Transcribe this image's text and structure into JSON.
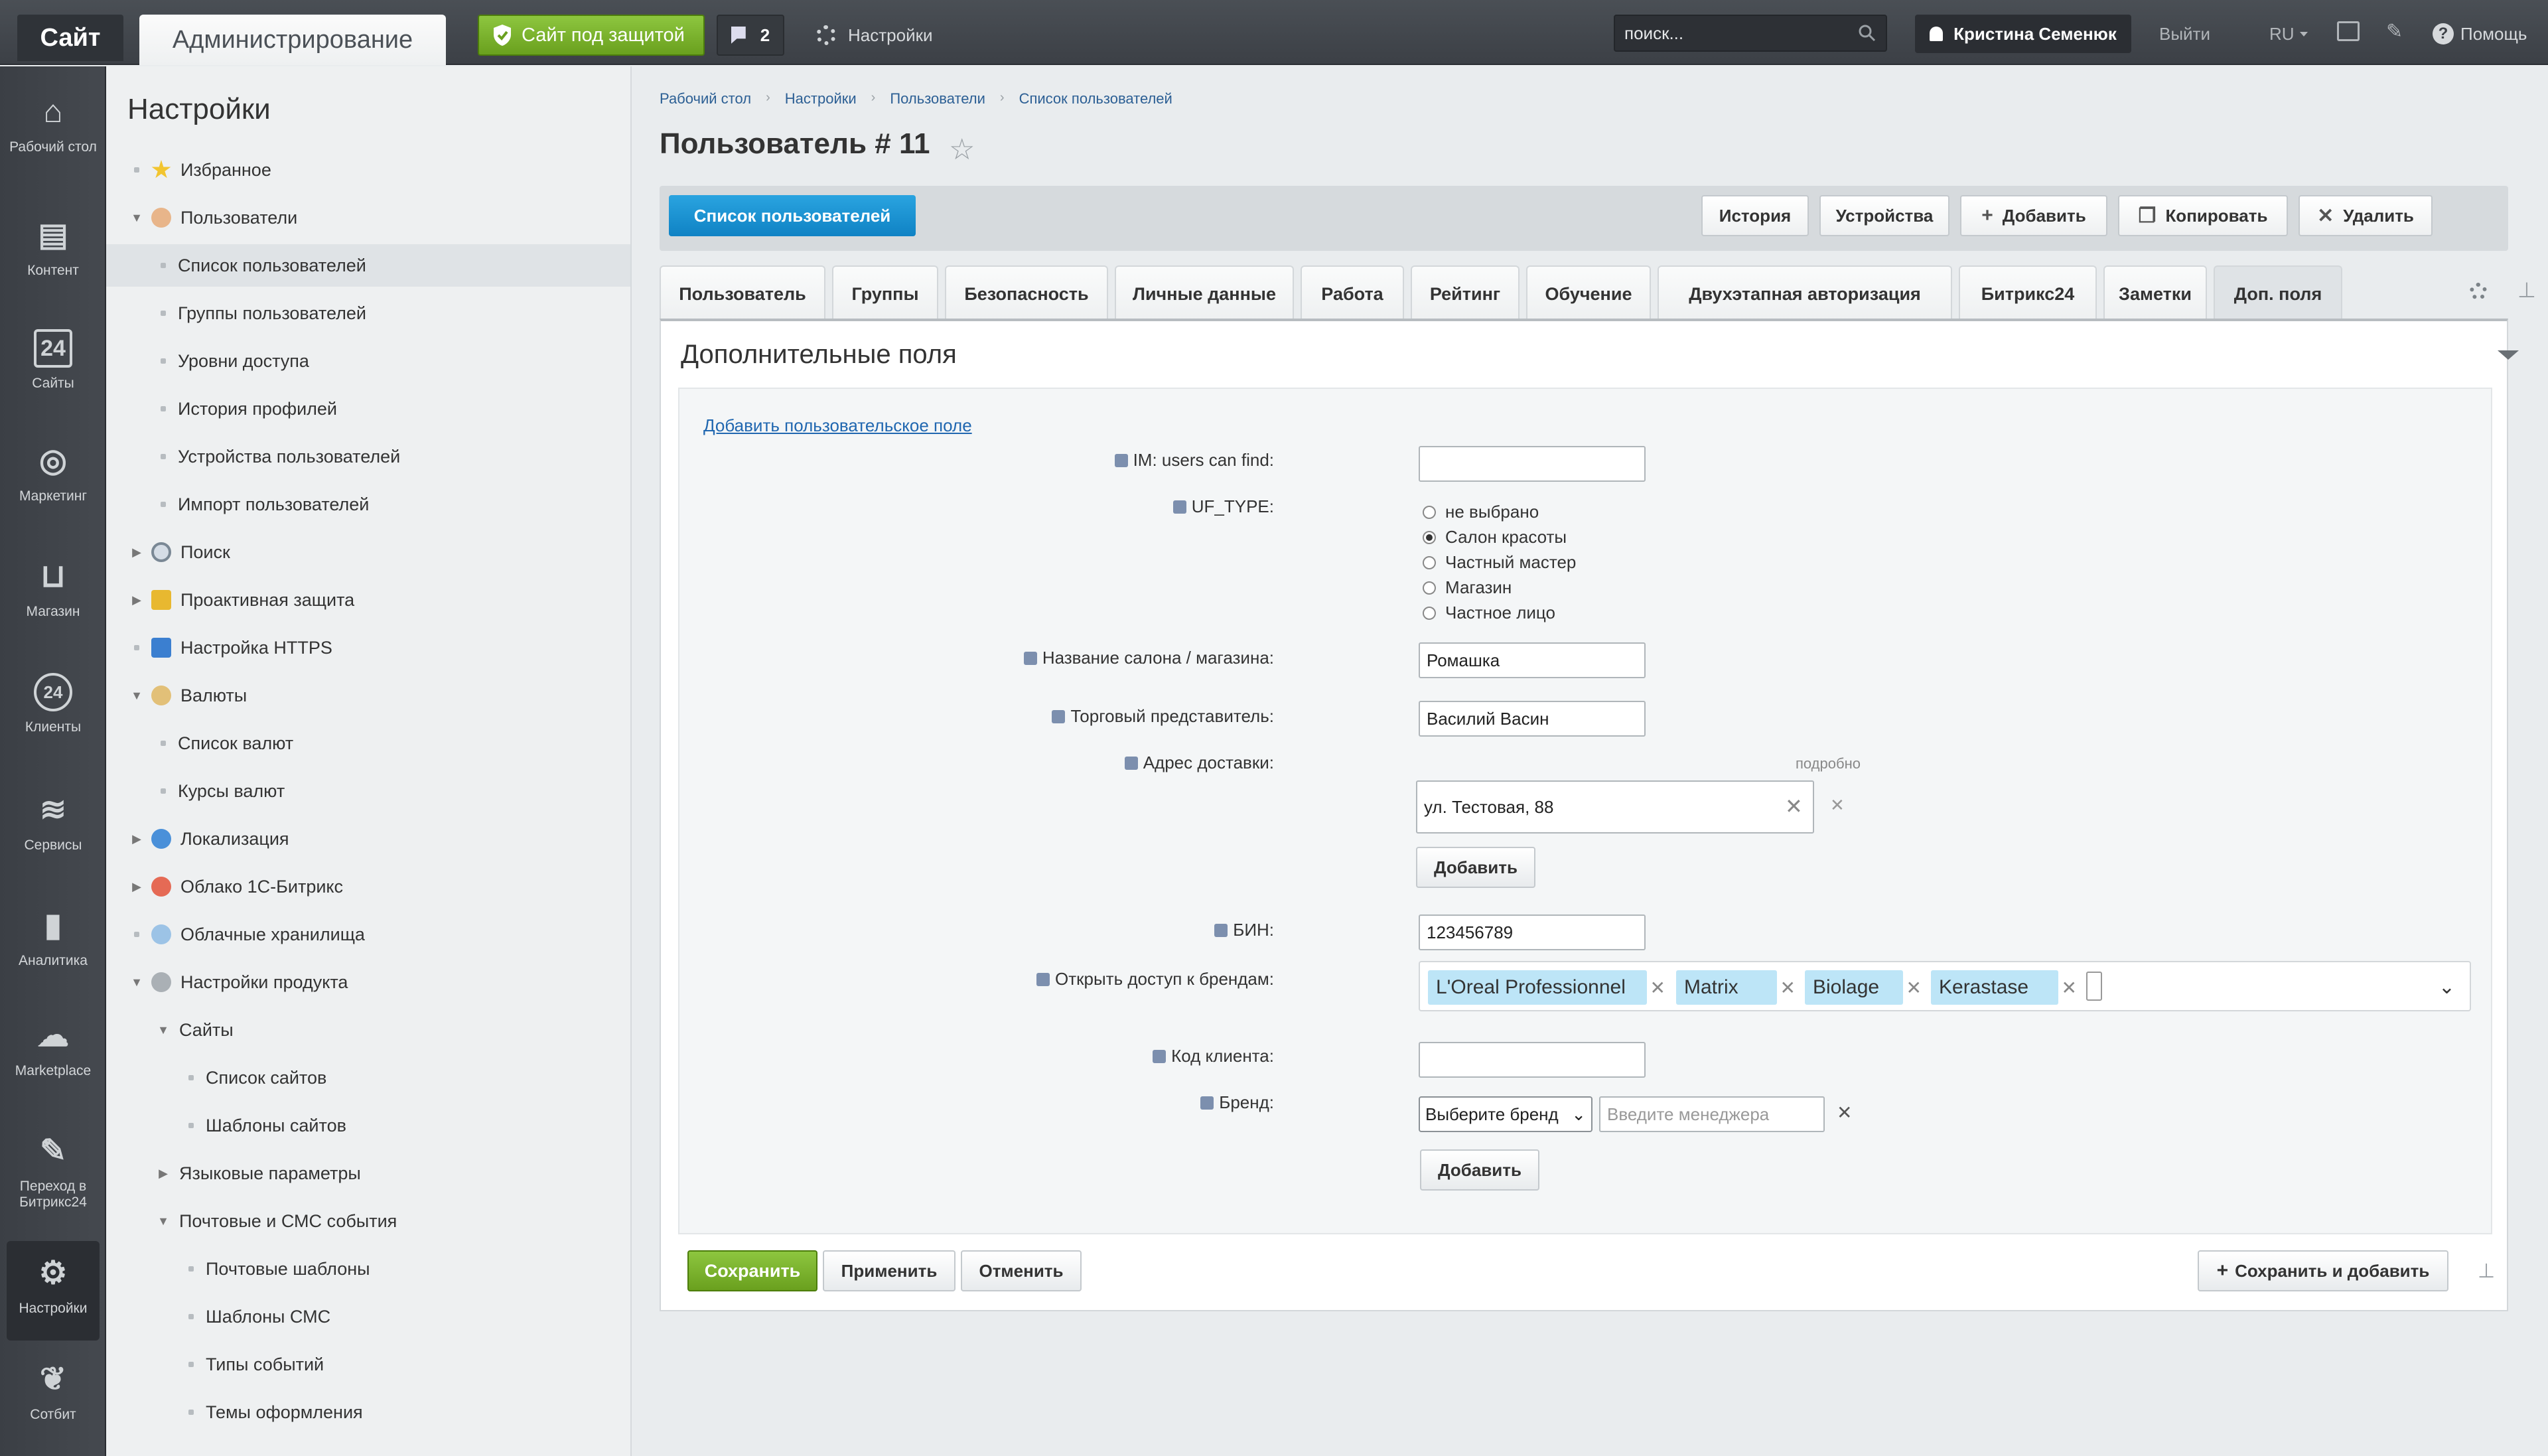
{
  "topbar": {
    "site": "Сайт",
    "admin": "Администрирование",
    "protect": "Сайт под защитой",
    "notifications": "2",
    "settings": "Настройки",
    "search_placeholder": "поиск...",
    "user": "Кристина Семенюк",
    "logout": "Выйти",
    "lang": "RU",
    "help": "Помощь"
  },
  "leftbar": [
    {
      "label": "Рабочий стол",
      "icon": "home-icon"
    },
    {
      "label": "Контент",
      "icon": "document-icon"
    },
    {
      "label": "Сайты",
      "icon": "calendar-24-icon"
    },
    {
      "label": "Маркетинг",
      "icon": "target-icon"
    },
    {
      "label": "Магазин",
      "icon": "basket-icon"
    },
    {
      "label": "Клиенты",
      "icon": "clients-24-icon"
    },
    {
      "label": "Сервисы",
      "icon": "layers-icon"
    },
    {
      "label": "Аналитика",
      "icon": "bar-chart-icon"
    },
    {
      "label": "Marketplace",
      "icon": "cloud-download-icon"
    },
    {
      "label": "Переход в Битрикс24",
      "icon": "bitrix24-icon"
    },
    {
      "label": "Настройки",
      "icon": "gear-icon"
    },
    {
      "label": "Сотбит",
      "icon": "sotbit-icon"
    }
  ],
  "menu": {
    "title": "Настройки",
    "items": [
      "Избранное",
      "Пользователи",
      "Список пользователей",
      "Группы пользователей",
      "Уровни доступа",
      "История профилей",
      "Устройства пользователей",
      "Импорт пользователей",
      "Поиск",
      "Проактивная защита",
      "Настройка HTTPS",
      "Валюты",
      "Список валют",
      "Курсы валют",
      "Локализация",
      "Облако 1С-Битрикс",
      "Облачные хранилища",
      "Настройки продукта",
      "Сайты",
      "Список сайтов",
      "Шаблоны сайтов",
      "Языковые параметры",
      "Почтовые и СМС события",
      "Почтовые шаблоны",
      "Шаблоны СМС",
      "Типы событий",
      "Темы оформления"
    ]
  },
  "breadcrumb": [
    "Рабочий стол",
    "Настройки",
    "Пользователи",
    "Список пользователей"
  ],
  "page_title": "Пользователь # 11",
  "toolbar": {
    "list_users": "Список пользователей",
    "history": "История",
    "devices": "Устройства",
    "add": "Добавить",
    "copy": "Копировать",
    "delete": "Удалить"
  },
  "tabs": [
    "Пользователь",
    "Группы",
    "Безопасность",
    "Личные данные",
    "Работа",
    "Рейтинг",
    "Обучение",
    "Двухэтапная авторизация",
    "Битрикс24",
    "Заметки",
    "Доп. поля"
  ],
  "section": {
    "title": "Дополнительные поля",
    "add_field_link": "Добавить пользовательское поле"
  },
  "fields": {
    "im_label": "IM: users can find:",
    "uf_type_label": "UF_TYPE:",
    "uf_type_options": [
      "не выбрано",
      "Салон красоты",
      "Частный мастер",
      "Магазин",
      "Частное лицо"
    ],
    "uf_type_selected": "Салон красоты",
    "salon_label": "Название салона / магазина:",
    "salon_value": "Ромашка",
    "rep_label": "Торговый представитель:",
    "rep_value": "Василий Васин",
    "address_label": "Адрес доставки:",
    "address_detail": "подробно",
    "address_value": "ул. Тестовая, 88",
    "add_btn": "Добавить",
    "bin_label": "БИН:",
    "bin_value": "123456789",
    "brands_label": "Открыть доступ к брендам:",
    "brands": [
      "L'Oreal Professionnel",
      "Matrix",
      "Biolage",
      "Kerastase"
    ],
    "client_code_label": "Код клиента:",
    "brand_label": "Бренд:",
    "brand_select": "Выберите бренд",
    "manager_placeholder": "Введите менеджера",
    "add_btn2": "Добавить"
  },
  "footer": {
    "save": "Сохранить",
    "apply": "Применить",
    "cancel": "Отменить",
    "save_add": "Сохранить и добавить"
  }
}
